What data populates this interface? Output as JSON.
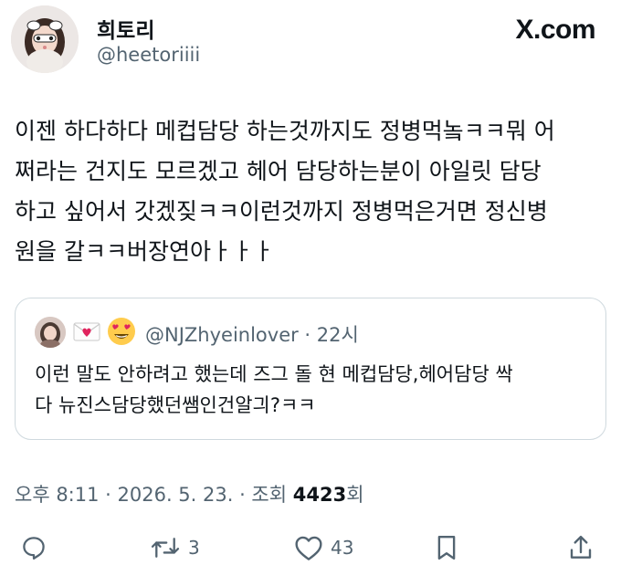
{
  "author": {
    "display_name": "희토리",
    "handle": "@heetoriiii"
  },
  "brand": {
    "logo_text": "X.com"
  },
  "tweet": {
    "text": "이젠 하다하다 메컵담당 하는것까지도 정병먹놐ㅋㅋ뭐 어\n쩌라는 건지도 모르겠고 헤어 담당하는분이 아일릿 담당\n하고 싶어서 갓겠짖ㅋㅋ이런것까지 정병먹은거면 정신병\n원을 갈ㅋㅋ버장연아ㅏㅏㅏ"
  },
  "quote": {
    "handle_time": "@NJZhyeinlover · 22시",
    "text": "이런 말도 안하려고 했는데 즈그 돌 현 메컵담당,헤어담당 싹\n다 뉴진스담당했던쌤인건알긔?ㅋㅋ"
  },
  "meta": {
    "time_date": "오후 8:11 · 2026. 5. 23. · 조회 ",
    "views": "4423",
    "views_suffix": "회"
  },
  "actions": {
    "reply_icon": "reply-icon",
    "retweet_icon": "retweet-icon",
    "retweet_count": "3",
    "like_icon": "heart-icon",
    "like_count": "43",
    "bookmark_icon": "bookmark-icon",
    "share_icon": "share-icon"
  },
  "colors": {
    "text_primary": "#0f1419",
    "text_secondary": "#536471",
    "border": "#cfd9de",
    "icon": "#536471"
  }
}
